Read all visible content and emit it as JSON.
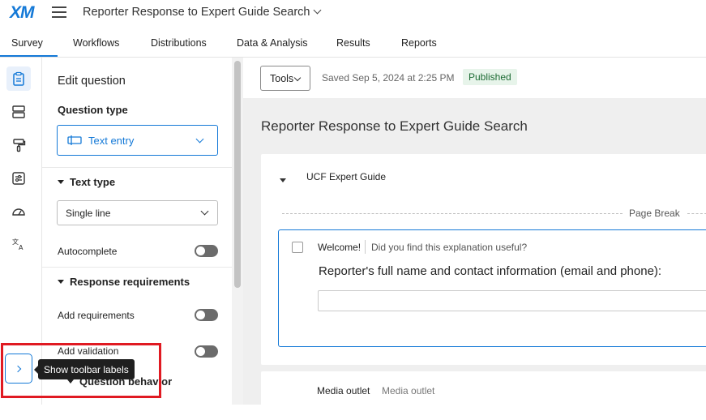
{
  "app": {
    "logo": "XM",
    "project_title": "Reporter Response to Expert Guide Search"
  },
  "nav_tabs": [
    {
      "label": "Survey",
      "active": true
    },
    {
      "label": "Workflows"
    },
    {
      "label": "Distributions"
    },
    {
      "label": "Data & Analysis"
    },
    {
      "label": "Results"
    },
    {
      "label": "Reports"
    }
  ],
  "icon_rail": [
    {
      "icon": "survey-clipboard-icon",
      "active": true
    },
    {
      "icon": "survey-flow-icon"
    },
    {
      "icon": "look-and-feel-paintbrush-icon"
    },
    {
      "icon": "survey-options-sliders-icon"
    },
    {
      "icon": "tools-gauge-icon"
    },
    {
      "icon": "translate-icon"
    }
  ],
  "edit_panel": {
    "title": "Edit question",
    "question_type_heading": "Question type",
    "question_type_value": "Text entry",
    "text_type_heading": "Text type",
    "text_type_value": "Single line",
    "autocomplete_label": "Autocomplete",
    "response_requirements_heading": "Response requirements",
    "add_requirements_label": "Add requirements",
    "add_validation_label": "Add validation",
    "question_behavior_heading": "Question behavior"
  },
  "toolbar": {
    "tools_label": "Tools",
    "saved_text": "Saved Sep 5, 2024 at 2:25 PM",
    "status_badge": "Published"
  },
  "survey": {
    "title": "Reporter Response to Expert Guide Search",
    "block_name": "UCF Expert Guide",
    "page_break_label": "Page Break",
    "question": {
      "id": "Welcome!",
      "description": "Did you find this explanation useful?",
      "text": "Reporter's full name and contact information (email and phone):"
    },
    "next_question": {
      "id": "Media outlet",
      "description": "Media outlet"
    }
  },
  "tooltip": {
    "show_labels": "Show toolbar labels"
  },
  "colors": {
    "accent": "#1479d7",
    "highlight": "#e01a22",
    "published_bg": "#e7f4ea"
  }
}
